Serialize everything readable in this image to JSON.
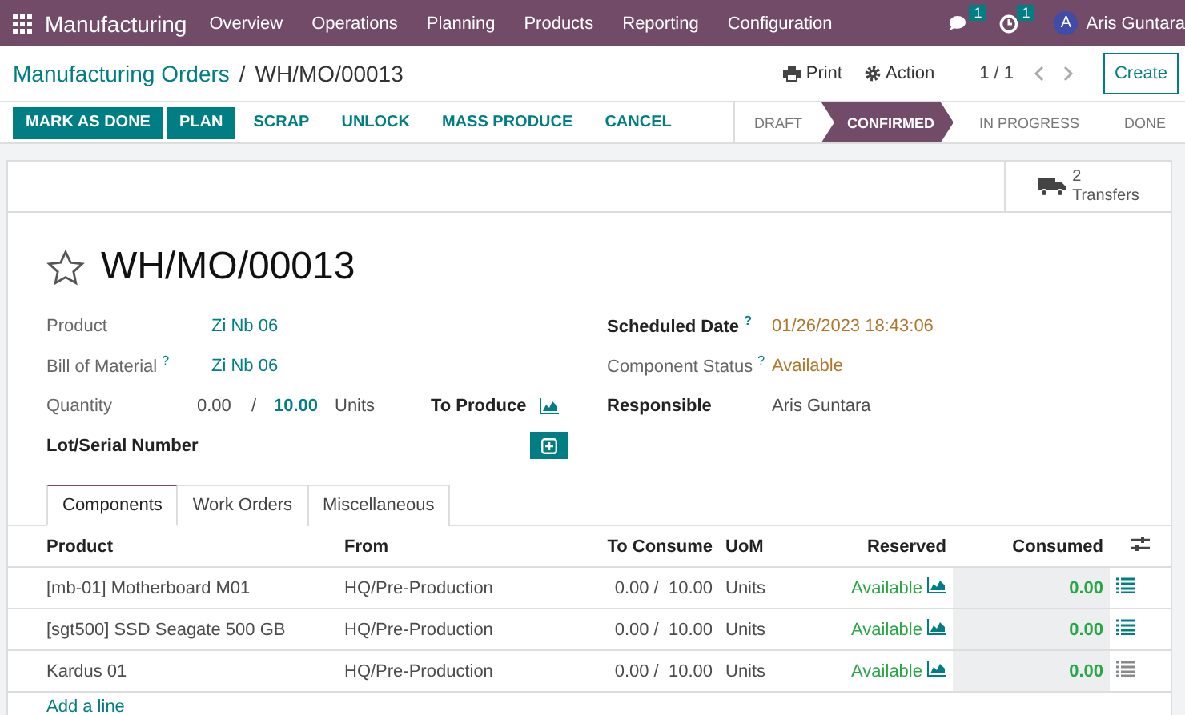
{
  "navbar": {
    "app": "Manufacturing",
    "menu": [
      "Overview",
      "Operations",
      "Planning",
      "Products",
      "Reporting",
      "Configuration"
    ],
    "messages_badge": "1",
    "activities_badge": "1",
    "avatar_letter": "A",
    "user": "Aris Guntara"
  },
  "breadcrumb": {
    "parent": "Manufacturing Orders",
    "separator": "/",
    "current": "WH/MO/00013"
  },
  "actions": {
    "print": "Print",
    "action": "Action",
    "pager": "1 / 1",
    "create": "Create"
  },
  "buttons": [
    {
      "label": "MARK AS DONE",
      "kind": "primary"
    },
    {
      "label": "PLAN",
      "kind": "primary"
    },
    {
      "label": "SCRAP",
      "kind": "link"
    },
    {
      "label": "UNLOCK",
      "kind": "link"
    },
    {
      "label": "MASS PRODUCE",
      "kind": "link"
    },
    {
      "label": "CANCEL",
      "kind": "link"
    }
  ],
  "stages": [
    {
      "label": "DRAFT",
      "selected": false
    },
    {
      "label": "CONFIRMED",
      "selected": true
    },
    {
      "label": "IN PROGRESS",
      "selected": false
    },
    {
      "label": "DONE",
      "selected": false
    }
  ],
  "smart_button": {
    "count": "2",
    "label": "Transfers"
  },
  "record": {
    "starred": false,
    "title": "WH/MO/00013"
  },
  "left_fields": {
    "product_label": "Product",
    "product": "Zi Nb 06",
    "bom_label": "Bill of Material",
    "bom_help": "?",
    "bom": "Zi Nb 06",
    "quantity_label": "Quantity",
    "produced": "0.00",
    "separator": "/",
    "quantity": "10.00",
    "uom": "Units",
    "to_produce": "To Produce",
    "lot_label": "Lot/Serial Number"
  },
  "right_fields": [
    {
      "label": "Scheduled Date",
      "help": "?",
      "bold": true,
      "value": "01/26/2023 18:43:06",
      "kind": "warning"
    },
    {
      "label": "Component Status",
      "help": "?",
      "bold": false,
      "value": "Available",
      "kind": "warning"
    },
    {
      "label": "Responsible",
      "bold": true,
      "value": "Aris Guntara",
      "kind": "plain"
    }
  ],
  "tabs": [
    {
      "label": "Components",
      "selected": true
    },
    {
      "label": "Work Orders",
      "selected": false
    },
    {
      "label": "Miscellaneous",
      "selected": false
    }
  ],
  "table": {
    "columns": [
      "Product",
      "From",
      "To Consume",
      "UoM",
      "Reserved",
      "Consumed"
    ],
    "rows": [
      {
        "product": "[mb-01] Motherboard M01",
        "from": "HQ/Pre-Production",
        "consumed_qty": "0.00 /",
        "to_consume": "10.00",
        "uom": "Units",
        "reserved": "Available",
        "consumed": "0.00",
        "detail_active": true
      },
      {
        "product": "[sgt500] SSD Seagate 500 GB",
        "from": "HQ/Pre-Production",
        "consumed_qty": "0.00 /",
        "to_consume": "10.00",
        "uom": "Units",
        "reserved": "Available",
        "consumed": "0.00",
        "detail_active": true
      },
      {
        "product": "Kardus 01",
        "from": "HQ/Pre-Production",
        "consumed_qty": "0.00 /",
        "to_consume": "10.00",
        "uom": "Units",
        "reserved": "Available",
        "consumed": "0.00",
        "detail_active": false
      }
    ],
    "add_line": "Add a line"
  }
}
